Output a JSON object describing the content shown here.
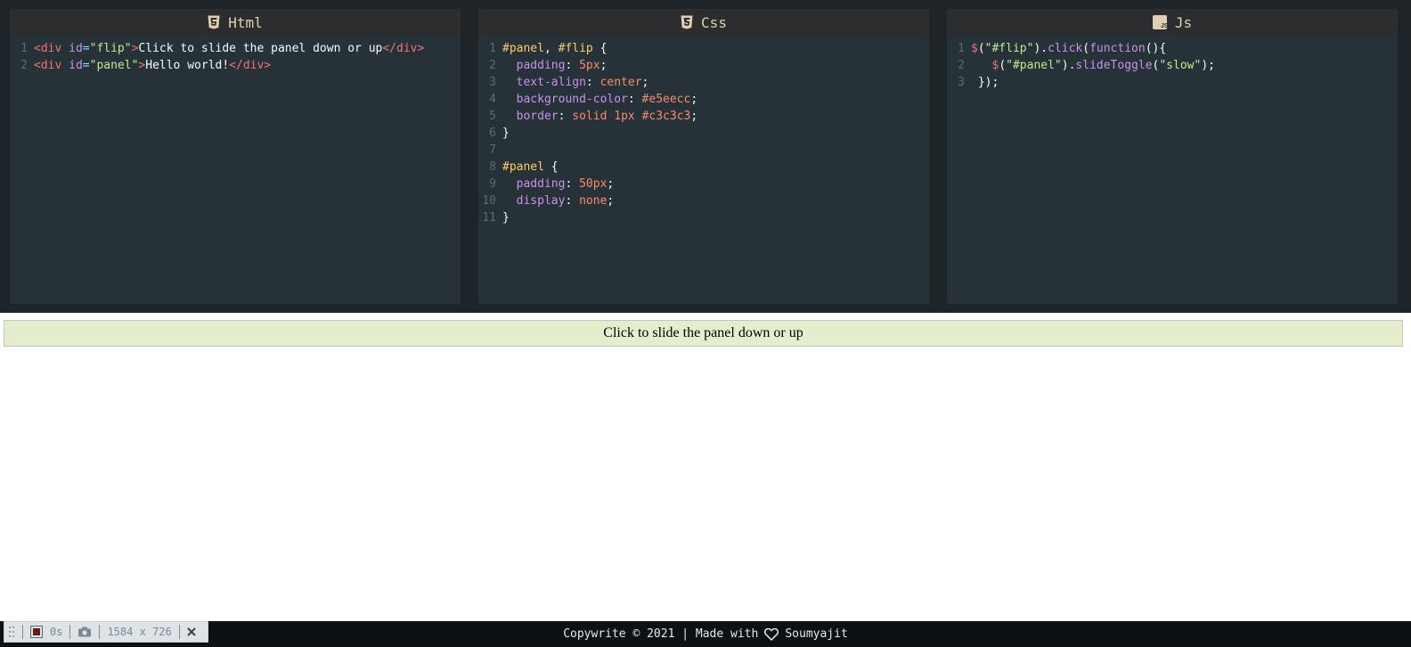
{
  "editors": {
    "html": {
      "title": "Html",
      "lines": [
        [
          {
            "t": "<div ",
            "c": "tag"
          },
          {
            "t": "id",
            "c": "attr"
          },
          {
            "t": "=",
            "c": "punct"
          },
          {
            "t": "\"flip\"",
            "c": "str"
          },
          {
            "t": ">",
            "c": "tag"
          },
          {
            "t": "Click to slide the panel down or up",
            "c": "text"
          },
          {
            "t": "</div>",
            "c": "tag"
          }
        ],
        [
          {
            "t": "<div ",
            "c": "tag"
          },
          {
            "t": "id",
            "c": "attr"
          },
          {
            "t": "=",
            "c": "punct"
          },
          {
            "t": "\"panel\"",
            "c": "str"
          },
          {
            "t": ">",
            "c": "tag"
          },
          {
            "t": "Hello world!",
            "c": "text"
          },
          {
            "t": "</div>",
            "c": "tag"
          }
        ]
      ]
    },
    "css": {
      "title": "Css",
      "lines": [
        [
          {
            "t": "#panel",
            "c": "sel"
          },
          {
            "t": ", ",
            "c": "text"
          },
          {
            "t": "#flip",
            "c": "sel"
          },
          {
            "t": " {",
            "c": "text"
          }
        ],
        [
          {
            "t": "  padding",
            "c": "prop"
          },
          {
            "t": ": ",
            "c": "text"
          },
          {
            "t": "5px",
            "c": "num"
          },
          {
            "t": ";",
            "c": "text"
          }
        ],
        [
          {
            "t": "  text-align",
            "c": "prop"
          },
          {
            "t": ": ",
            "c": "text"
          },
          {
            "t": "center",
            "c": "kw"
          },
          {
            "t": ";",
            "c": "text"
          }
        ],
        [
          {
            "t": "  background-color",
            "c": "prop"
          },
          {
            "t": ": ",
            "c": "text"
          },
          {
            "t": "#e5eecc",
            "c": "kw"
          },
          {
            "t": ";",
            "c": "text"
          }
        ],
        [
          {
            "t": "  border",
            "c": "prop"
          },
          {
            "t": ": ",
            "c": "text"
          },
          {
            "t": "solid ",
            "c": "kw"
          },
          {
            "t": "1px ",
            "c": "num"
          },
          {
            "t": "#c3c3c3",
            "c": "kw"
          },
          {
            "t": ";",
            "c": "text"
          }
        ],
        [
          {
            "t": "}",
            "c": "text"
          }
        ],
        [],
        [
          {
            "t": "#panel",
            "c": "sel"
          },
          {
            "t": " {",
            "c": "text"
          }
        ],
        [
          {
            "t": "  padding",
            "c": "prop"
          },
          {
            "t": ": ",
            "c": "text"
          },
          {
            "t": "50px",
            "c": "num"
          },
          {
            "t": ";",
            "c": "text"
          }
        ],
        [
          {
            "t": "  display",
            "c": "prop"
          },
          {
            "t": ": ",
            "c": "text"
          },
          {
            "t": "none",
            "c": "kw"
          },
          {
            "t": ";",
            "c": "text"
          }
        ],
        [
          {
            "t": "}",
            "c": "text"
          }
        ]
      ]
    },
    "js": {
      "title": "Js",
      "lines": [
        [
          {
            "t": "$",
            "c": "tag"
          },
          {
            "t": "(",
            "c": "text"
          },
          {
            "t": "\"#flip\"",
            "c": "str"
          },
          {
            "t": ").",
            "c": "text"
          },
          {
            "t": "click",
            "c": "attr"
          },
          {
            "t": "(",
            "c": "text"
          },
          {
            "t": "function",
            "c": "attr"
          },
          {
            "t": "(){",
            "c": "text"
          }
        ],
        [
          {
            "t": "   ",
            "c": "text"
          },
          {
            "t": "$",
            "c": "tag"
          },
          {
            "t": "(",
            "c": "text"
          },
          {
            "t": "\"#panel\"",
            "c": "str"
          },
          {
            "t": ").",
            "c": "text"
          },
          {
            "t": "slideToggle",
            "c": "attr"
          },
          {
            "t": "(",
            "c": "text"
          },
          {
            "t": "\"slow\"",
            "c": "str"
          },
          {
            "t": ");",
            "c": "text"
          }
        ],
        [
          {
            "t": " });",
            "c": "text"
          }
        ]
      ]
    }
  },
  "preview": {
    "flip_text": "Click to slide the panel down or up"
  },
  "footer": {
    "prefix": "Copywrite © 2021 | Made with",
    "author": "Soumyajit"
  },
  "fps_bar": {
    "time": "0s",
    "size": "1584 x 726"
  },
  "colors": {
    "editor_bg": "#263238",
    "header_bg": "#2b2d2e",
    "flip_bg": "#e5eecc",
    "flip_border": "#c3c3c3"
  }
}
